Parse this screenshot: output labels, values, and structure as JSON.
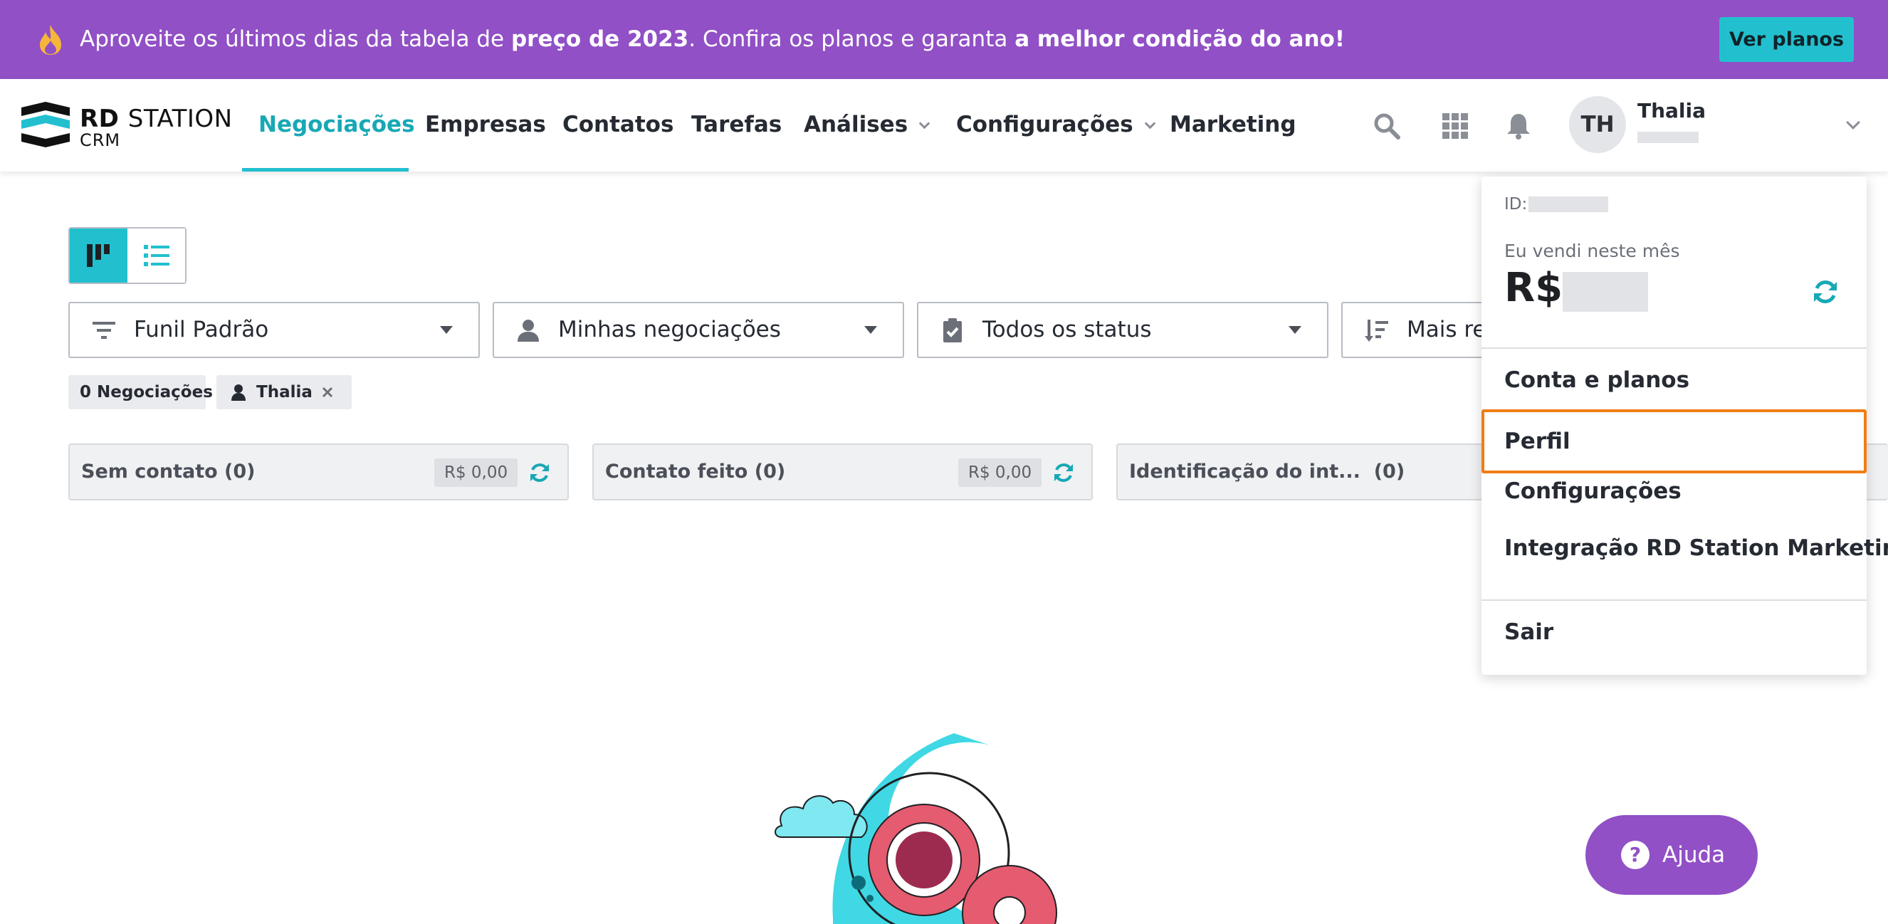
{
  "banner": {
    "text_1": "Aproveite os últimos dias da tabela de ",
    "text_2": "preço de 2023",
    "text_3": ". Confira os planos e garanta ",
    "text_4": "a melhor condição do ano!",
    "cta_label": "Ver planos"
  },
  "logo": {
    "brand_bold": "RD",
    "brand_rest": "STATION",
    "sub": "CRM"
  },
  "nav": {
    "items": [
      {
        "label": "Negociações"
      },
      {
        "label": "Empresas"
      },
      {
        "label": "Contatos"
      },
      {
        "label": "Tarefas"
      },
      {
        "label": "Análises"
      },
      {
        "label": "Configurações"
      },
      {
        "label": "Marketing"
      }
    ],
    "icons": [
      "search-icon",
      "apps-grid-icon",
      "bell-icon"
    ]
  },
  "user": {
    "initials": "TH",
    "name": "Thalia"
  },
  "filters": [
    {
      "label": "Funil Padrão",
      "icon": "funnel-icon"
    },
    {
      "label": "Minhas negociações",
      "icon": "person-icon"
    },
    {
      "label": "Todos os status",
      "icon": "clipboard-check-icon"
    },
    {
      "label": "Mais re",
      "icon": "sort-icon"
    }
  ],
  "chips": {
    "count": "0 Negociações",
    "owner": "Thalia"
  },
  "stages": [
    {
      "name": "Sem contato (0)",
      "value": "R$ 0,00"
    },
    {
      "name": "Contato feito (0)",
      "value": "R$ 0,00"
    },
    {
      "name": "Identificação do int...  (0)"
    }
  ],
  "menu": {
    "id_label": "ID:",
    "sold_label": "Eu vendi neste mês",
    "currency": "R$",
    "items": [
      "Conta e planos",
      "Perfil",
      "Configurações",
      "Integração RD Station Marketing",
      "Sair"
    ]
  },
  "help": {
    "label": "Ajuda",
    "glyph": "?"
  },
  "colors": {
    "brand_purple": "#9150c6",
    "accent_teal": "#22c0cf",
    "active_nav": "#18a8b5",
    "highlight_orange": "#f07d14"
  }
}
